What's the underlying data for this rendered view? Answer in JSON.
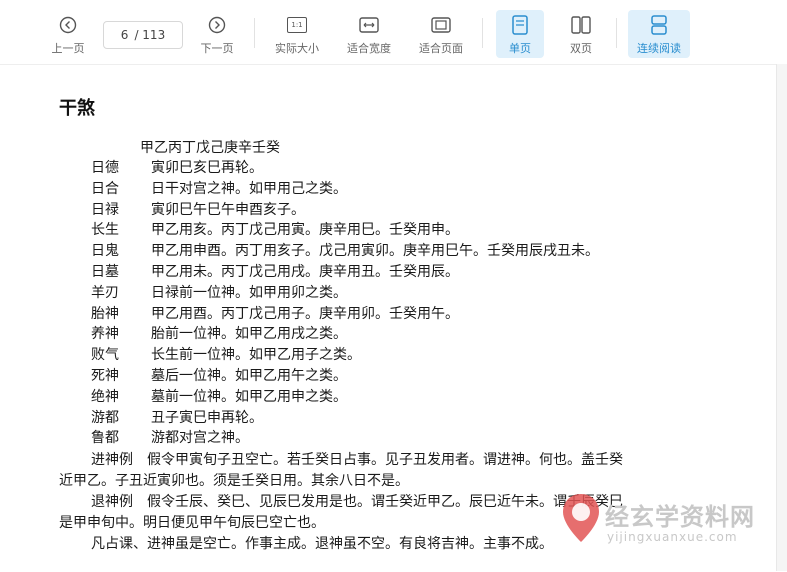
{
  "toolbar": {
    "prev_label": "上一页",
    "page_current": "6",
    "page_total": "/ 113",
    "next_label": "下一页",
    "actual_size_label": "实际大小",
    "fit_width_label": "适合宽度",
    "fit_page_label": "适合页面",
    "single_page_label": "单页",
    "double_page_label": "双页",
    "continuous_label": "连续阅读",
    "actual_size_icon_text": "1:1",
    "accent_color": "#2a8ecf"
  },
  "document": {
    "title": "干煞",
    "header_line": "甲乙丙丁戊己庚辛壬癸",
    "entries": [
      {
        "term": "日德",
        "text": "寅卯巳亥巳再轮。"
      },
      {
        "term": "日合",
        "text": "日干对宫之神。如甲用己之类。"
      },
      {
        "term": "日禄",
        "text": "寅卯巳午巳午申酉亥子。"
      },
      {
        "term": "长生",
        "text": "甲乙用亥。丙丁戊己用寅。庚辛用巳。壬癸用申。"
      },
      {
        "term": "日鬼",
        "text": "甲乙用申酉。丙丁用亥子。戊己用寅卯。庚辛用巳午。壬癸用辰戌丑未。"
      },
      {
        "term": "日墓",
        "text": "甲乙用未。丙丁戊己用戌。庚辛用丑。壬癸用辰。"
      },
      {
        "term": "羊刃",
        "text": "日禄前一位神。如甲用卯之类。"
      },
      {
        "term": "胎神",
        "text": "甲乙用酉。丙丁戊己用子。庚辛用卯。壬癸用午。"
      },
      {
        "term": "养神",
        "text": "胎前一位神。如甲乙用戌之类。"
      },
      {
        "term": "败气",
        "text": "长生前一位神。如甲乙用子之类。"
      },
      {
        "term": "死神",
        "text": "墓后一位神。如甲乙用午之类。"
      },
      {
        "term": "绝神",
        "text": "墓前一位神。如甲乙用申之类。"
      },
      {
        "term": "游都",
        "text": "丑子寅巳申再轮。"
      },
      {
        "term": "鲁都",
        "text": "游都对宫之神。"
      }
    ],
    "para1_term": "进神例",
    "para1_line1": "假令甲寅旬子丑空亡。若壬癸日占事。见子丑发用者。谓进神。何也。盖壬癸",
    "para1_line2": "近甲乙。子丑近寅卯也。须是壬癸日用。其余八日不是。",
    "para2_term": "退神例",
    "para2_line1": "假令壬辰、癸巳、见辰巳发用是也。谓壬癸近甲乙。辰巳近午未。谓壬辰癸巳",
    "para2_line2": "是甲申旬中。明日便见甲午旬辰巳空亡也。",
    "para3": "凡占课、进神虽是空亡。作事主成。退神虽不空。有良将吉神。主事不成。"
  },
  "watermark": {
    "text": "经玄学资料网",
    "url": "yijingxuanxue.com"
  }
}
